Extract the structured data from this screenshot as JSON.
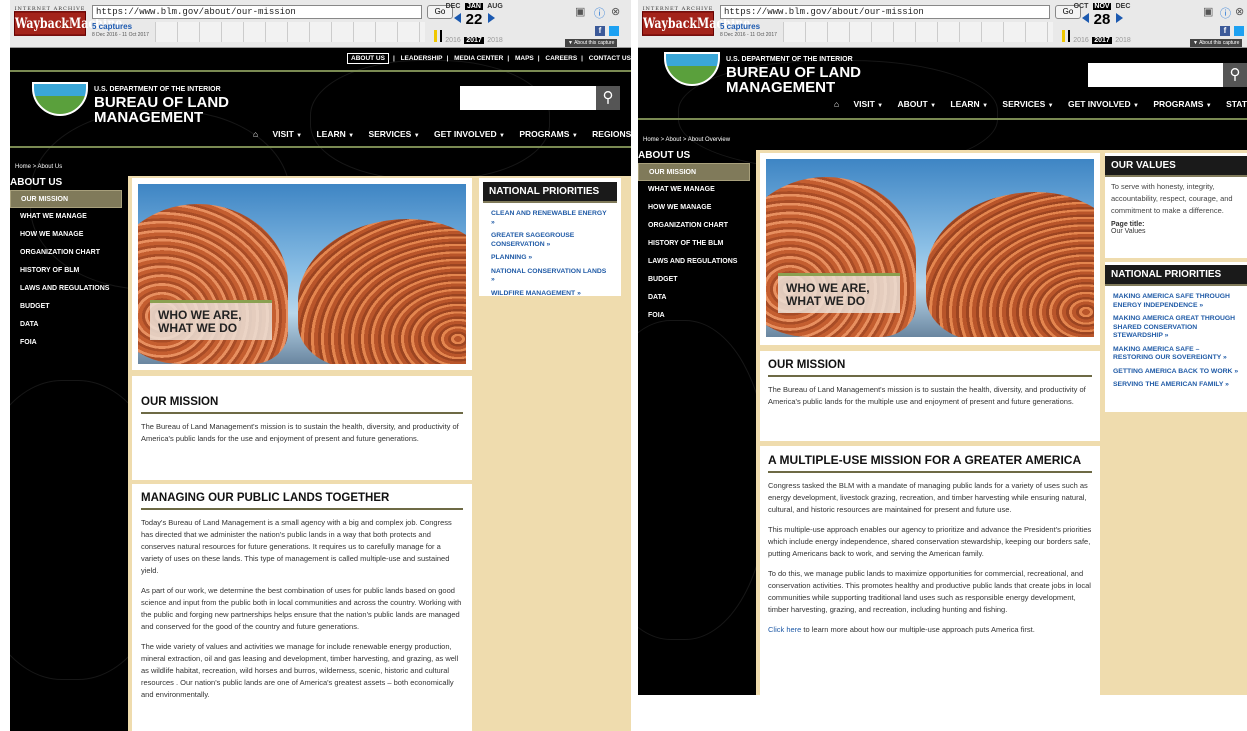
{
  "wayback": {
    "url": "https://www.blm.gov/about/our-mission",
    "go": "Go",
    "captures": "5 captures",
    "range": "8 Dec 2016 - 11 Oct 2017",
    "about_capture": "About this capture",
    "logo_top": "INTERNET ARCHIVE",
    "logo_main": "WaybackMachine"
  },
  "left": {
    "wayback_months": [
      "DEC",
      "JAN",
      "AUG"
    ],
    "wayback_day": "22",
    "wayback_years": [
      "2016",
      "2017",
      "2018"
    ],
    "utility_nav": [
      "ABOUT US",
      "LEADERSHIP",
      "MEDIA CENTER",
      "MAPS",
      "CAREERS",
      "CONTACT US"
    ],
    "dept": "U.S. DEPARTMENT OF THE INTERIOR",
    "agency_line1": "BUREAU OF LAND",
    "agency_line2": "MANAGEMENT",
    "main_nav": [
      "VISIT",
      "LEARN",
      "SERVICES",
      "GET INVOLVED",
      "PROGRAMS",
      "REGIONS"
    ],
    "breadcrumb": "Home > About Us",
    "section_heading": "ABOUT US",
    "sidebar": [
      "OUR MISSION",
      "WHAT WE MANAGE",
      "HOW WE MANAGE",
      "ORGANIZATION CHART",
      "HISTORY OF BLM",
      "LAWS AND REGULATIONS",
      "BUDGET",
      "DATA",
      "FOIA"
    ],
    "hero_caption_1": "WHO WE ARE,",
    "hero_caption_2": "WHAT WE DO",
    "mission_heading": "OUR MISSION",
    "mission_text": "The Bureau of Land Management's mission is to sustain the health, diversity, and productivity of America's public lands for the use and enjoyment of present and future generations.",
    "managing_heading": "MANAGING OUR PUBLIC LANDS TOGETHER",
    "managing_p1": "Today's Bureau of Land Management is a small agency with a big and complex job.  Congress has directed that we administer the nation's public lands in a way that both protects and conserves natural resources for future generations. It requires us to carefully manage for a variety of uses on these lands.  This type of management is called multiple-use and sustained yield.",
    "managing_p2": "As part of our work, we determine the best combination of uses for public lands based on good science and input from the public both in local communities and across the country.  Working with the public and forging new partnerships helps ensure that the nation's public lands are managed and conserved for the good of the country and future generations.",
    "managing_p3": "The wide variety of values and activities we manage for include renewable energy production, mineral extraction, oil and gas leasing and development, timber harvesting, and grazing, as well as wildlife habitat, recreation, wild horses and burros, wilderness, scenic, historic and cultural resources .  Our nation's public lands are one of America's greatest assets – both economically and environmentally.",
    "priorities_heading": "NATIONAL PRIORITIES",
    "priorities": [
      "CLEAN AND RENEWABLE ENERGY »",
      "GREATER SAGEGROUSE CONSERVATION »",
      "PLANNING »",
      "NATIONAL CONSERVATION LANDS »",
      "WILDFIRE MANAGEMENT »"
    ]
  },
  "right": {
    "wayback_months": [
      "OCT",
      "NOV",
      "DEC"
    ],
    "wayback_day": "28",
    "wayback_years": [
      "2016",
      "2017",
      "2018"
    ],
    "dept": "U.S. DEPARTMENT OF THE INTERIOR",
    "agency_line1": "BUREAU OF LAND",
    "agency_line2": "MANAGEMENT",
    "main_nav": [
      "VISIT",
      "ABOUT",
      "LEARN",
      "SERVICES",
      "GET INVOLVED",
      "PROGRAMS",
      "STATES"
    ],
    "breadcrumb": "Home > About > About Overview",
    "section_heading": "ABOUT US",
    "sidebar": [
      "OUR MISSION",
      "WHAT WE MANAGE",
      "HOW WE MANAGE",
      "ORGANIZATION CHART",
      "HISTORY OF THE BLM",
      "LAWS AND REGULATIONS",
      "BUDGET",
      "DATA",
      "FOIA"
    ],
    "hero_caption_1": "WHO WE ARE,",
    "hero_caption_2": "WHAT WE DO",
    "mission_heading": "OUR MISSION",
    "mission_text": "The Bureau of Land Management's mission is to sustain the health, diversity, and productivity of America's public lands for the multiple use and enjoyment of present and future generations.",
    "multiuse_heading": "A MULTIPLE-USE MISSION FOR A GREATER AMERICA",
    "multiuse_p1": "Congress tasked the BLM with a mandate of managing public lands for a variety of uses such as energy development, livestock grazing, recreation, and timber harvesting while ensuring natural, cultural, and historic resources are maintained for present and future use.",
    "multiuse_p2": "This multiple-use approach enables our agency to prioritize and advance the President's priorities which include energy independence, shared conservation stewardship, keeping our borders safe, putting Americans back to work, and serving the American family.",
    "multiuse_p3": "To do this, we manage public lands to maximize opportunities for commercial, recreational, and conservation activities.  This promotes healthy and productive public lands that create jobs in local communities while supporting traditional land uses such as responsible energy development, timber harvesting, grazing, and recreation, including hunting and fishing.",
    "click_here": "Click here",
    "click_rest": " to learn more about how our multiple-use approach puts America first.",
    "values_heading": "OUR VALUES",
    "values_text": "To serve with honesty, integrity, accountability, respect, courage, and commitment to make a difference.",
    "page_title_label": "Page title:",
    "page_title_value": "Our Values",
    "priorities_heading": "NATIONAL PRIORITIES",
    "priorities": [
      "MAKING AMERICA SAFE THROUGH ENERGY INDEPENDENCE »",
      "MAKING AMERICA GREAT THROUGH SHARED CONSERVATION STEWARDSHIP »",
      "MAKING AMERICA SAFE – RESTORING OUR SOVEREIGNTY »",
      "GETTING AMERICA BACK TO WORK »",
      "SERVING THE AMERICAN FAMILY »"
    ]
  },
  "colors": {
    "accent_link": "#1f5aa6",
    "panel_bg": "#000000",
    "tan": "#efdcae",
    "olive": "#807a5a"
  }
}
